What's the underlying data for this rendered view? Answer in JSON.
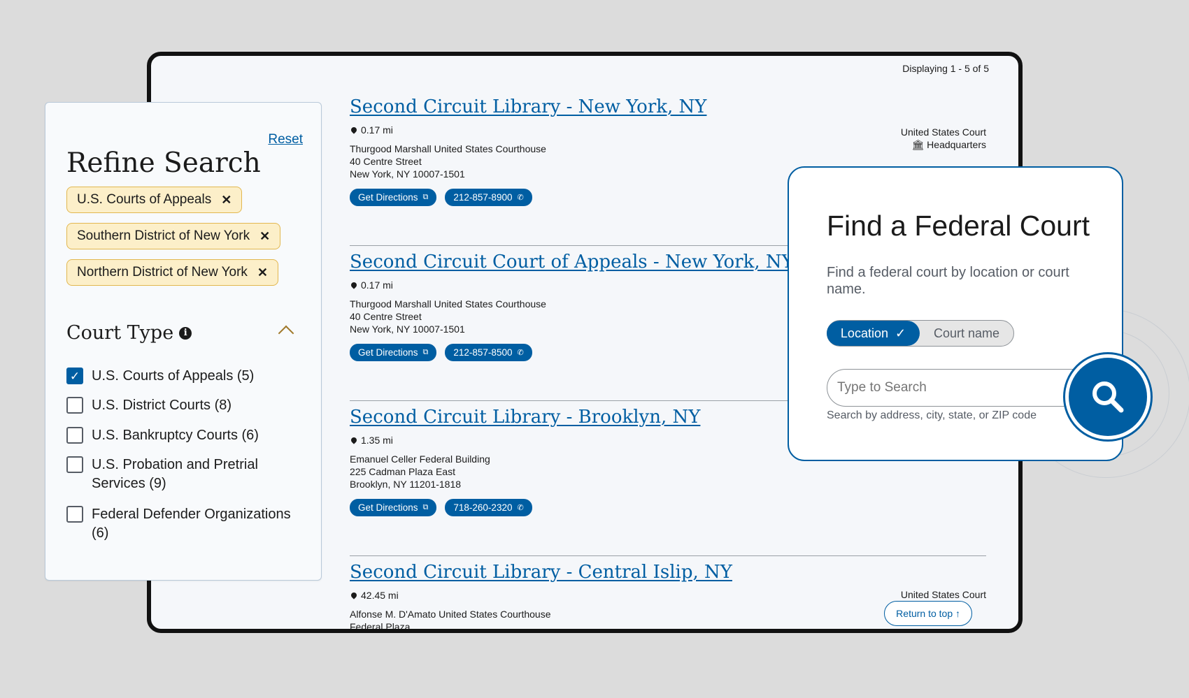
{
  "results": {
    "displaying": "Displaying 1 - 5 of 5",
    "items": [
      {
        "title": "Second Circuit Library - New York, NY",
        "distance": "0.17 mi",
        "address": [
          "Thurgood Marshall United States Courthouse",
          "40 Centre Street",
          "New York, NY 10007-1501"
        ],
        "directions_label": "Get Directions",
        "phone": "212-857-8900",
        "type_lines": [
          "United States Court",
          "Headquarters"
        ]
      },
      {
        "title": "Second Circuit Court of Appeals - New York, NY",
        "distance": "0.17 mi",
        "address": [
          "Thurgood Marshall United States Courthouse",
          "40 Centre Street",
          "New York, NY 10007-1501"
        ],
        "directions_label": "Get Directions",
        "phone": "212-857-8500"
      },
      {
        "title": "Second Circuit Library - Brooklyn, NY",
        "distance": "1.35 mi",
        "address": [
          "Emanuel Celler Federal Building",
          "225 Cadman Plaza East",
          "Brooklyn, NY 11201-1818"
        ],
        "directions_label": "Get Directions",
        "phone": "718-260-2320"
      },
      {
        "title": "Second Circuit Library - Central Islip, NY",
        "distance": "42.45 mi",
        "address": [
          "Alfonse M. D'Amato United States Courthouse",
          "Federal Plaza"
        ],
        "type_lines": [
          "United States Court"
        ]
      }
    ],
    "return_to_top": "Return to top"
  },
  "refine": {
    "title": "Refine Search",
    "reset": "Reset",
    "chips": [
      "U.S. Courts of Appeals",
      "Southern District of New York",
      "Northern District of New York"
    ],
    "court_type_title": "Court Type",
    "court_types": [
      {
        "label": "U.S. Courts of Appeals (5)",
        "checked": true
      },
      {
        "label": "U.S. District Courts (8)",
        "checked": false
      },
      {
        "label": "U.S. Bankruptcy Courts (6)",
        "checked": false
      },
      {
        "label": "U.S. Probation and Pretrial Services (9)",
        "checked": false
      },
      {
        "label": "Federal Defender Organizations (6)",
        "checked": false
      }
    ]
  },
  "find": {
    "title": "Find a Federal Court",
    "subtitle": "Find a federal court by location or court name.",
    "toggle_location": "Location",
    "toggle_court_name": "Court name",
    "search_placeholder": "Type to Search",
    "hint": "Search by address, city, state, or ZIP code"
  },
  "colors": {
    "primary": "#005ea2",
    "chip_bg": "#fcefc9",
    "chip_border": "#e2b74f",
    "background": "#dcdcdc"
  }
}
